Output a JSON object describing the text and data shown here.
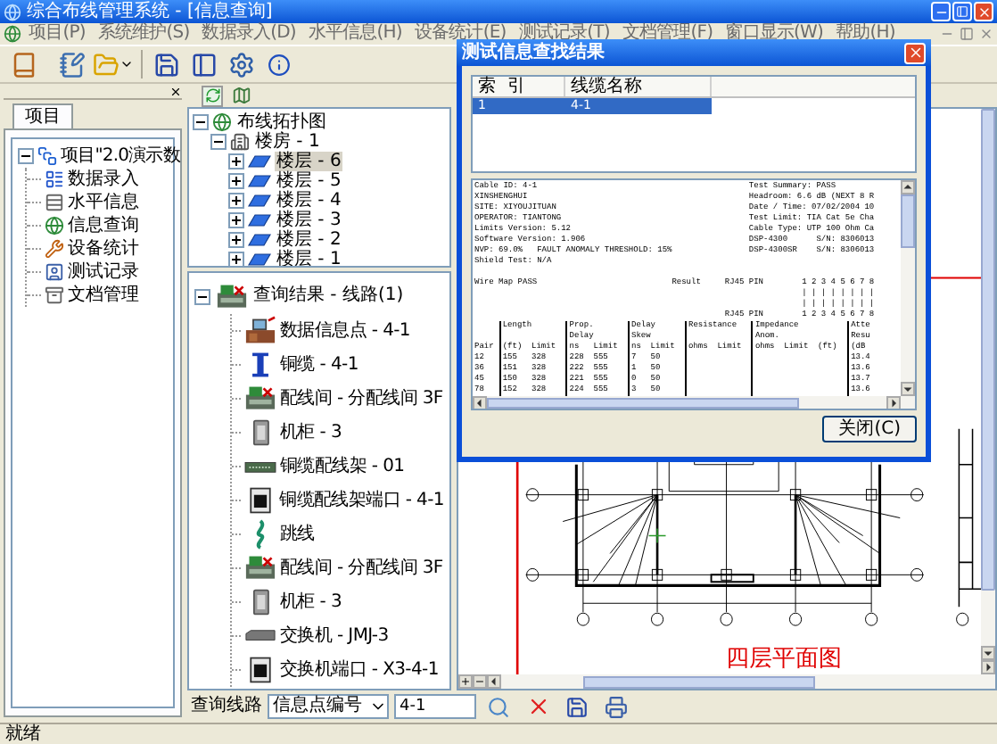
{
  "window": {
    "title": "综合布线管理系统 - [信息查询]"
  },
  "menu": [
    "项目(P)",
    "系统维护(S)",
    "数据录入(D)",
    "水平信息(H)",
    "设备统计(E)",
    "测试记录(T)",
    "文档管理(F)",
    "窗口显示(W)",
    "帮助(H)"
  ],
  "project_panel": {
    "tab": "项目",
    "tree": {
      "label": "项目\"2.0演示数",
      "kind": "project",
      "expanded": true,
      "children": [
        {
          "label": "数据录入",
          "kind": "entry"
        },
        {
          "label": "水平信息",
          "kind": "horizontal"
        },
        {
          "label": "信息查询",
          "kind": "query"
        },
        {
          "label": "设备统计",
          "kind": "stats"
        },
        {
          "label": "测试记录",
          "kind": "test"
        },
        {
          "label": "文档管理",
          "kind": "docs"
        }
      ]
    }
  },
  "topology_tree": {
    "label": "布线拓扑图",
    "kind": "map",
    "expanded": true,
    "children": [
      {
        "label": "楼房 - 1",
        "kind": "building",
        "expanded": true,
        "children": [
          {
            "label": "楼层 - 6",
            "kind": "floor",
            "expanded": false,
            "selected": true
          },
          {
            "label": "楼层 - 5",
            "kind": "floor",
            "expanded": false,
            "selected": false
          },
          {
            "label": "楼层 - 4",
            "kind": "floor",
            "expanded": false,
            "selected": false
          },
          {
            "label": "楼层 - 3",
            "kind": "floor",
            "expanded": false,
            "selected": false
          },
          {
            "label": "楼层 - 2",
            "kind": "floor",
            "expanded": false,
            "selected": false
          },
          {
            "label": "楼层 - 1",
            "kind": "floor",
            "expanded": false,
            "selected": false
          }
        ]
      }
    ]
  },
  "result_tree": {
    "label": "查询结果 - 线路(1)",
    "kind": "room",
    "expanded": true,
    "children": [
      {
        "label": "数据信息点 - 4-1",
        "kind": "outlet"
      },
      {
        "label": "铜缆 - 4-1",
        "kind": "cable"
      },
      {
        "label": "配线间 - 分配线间 3F",
        "kind": "room"
      },
      {
        "label": "机柜 - 3",
        "kind": "cabinet"
      },
      {
        "label": "铜缆配线架 - 01",
        "kind": "panel"
      },
      {
        "label": "铜缆配线架端口 - 4-1",
        "kind": "port"
      },
      {
        "label": "跳线",
        "kind": "jumper"
      },
      {
        "label": "配线间 - 分配线间 3F",
        "kind": "room"
      },
      {
        "label": "机柜 - 3",
        "kind": "cabinet"
      },
      {
        "label": "交换机 - JMJ-3",
        "kind": "switch"
      },
      {
        "label": "交换机端口 - X3-4-1",
        "kind": "port"
      }
    ]
  },
  "query_bar": {
    "label": "查询线路",
    "field": "信息点编号",
    "value": "4-1"
  },
  "drawing": {
    "caption": "四层平面图"
  },
  "dialog": {
    "title": "测试信息查找结果",
    "columns": [
      "索  引",
      "线缆名称"
    ],
    "rows": [
      {
        "cells": [
          "1",
          "4-1"
        ],
        "selected": true
      }
    ],
    "report": {
      "header": [
        {
          "left": "Cable ID: 4-1",
          "right": "Test Summary: PASS"
        },
        {
          "left": "XINSHENGHUI",
          "right": "Headroom: 6.6 dB (NEXT 8 R"
        },
        {
          "left": "SITE: XIYOUJITUAN",
          "right": "Date / Time: 07/02/2004 10"
        },
        {
          "left": "OPERATOR: TIANTONG",
          "right": "Test Limit: TIA Cat 5e Cha"
        },
        {
          "left": "Limits Version: 5.12",
          "right": "Cable Type: UTP 100 Ohm Ca"
        },
        {
          "left": "Software Version: 1.906",
          "right": "DSP-4300      S/N: 8306013"
        },
        {
          "left": "NVP: 69.0%   FAULT ANOMALY THRESHOLD: 15%",
          "right": "DSP-4300SR    S/N: 8306013"
        },
        {
          "left": "Shield Test: N/A"
        }
      ],
      "wire_map": [
        {
          "kind": "result",
          "cells": [
            "Wire Map PASS",
            "Result",
            "RJ45 PIN",
            "1 2 3 4 5 6 7 8"
          ]
        },
        {
          "kind": "bars",
          "cells": [
            "| | | | | | | |"
          ]
        },
        {
          "kind": "bars",
          "cells": [
            "| | | | | | | |"
          ]
        },
        {
          "kind": "pins",
          "cells": [
            "RJ45 PIN",
            "1 2 3 4 5 6 7 8"
          ]
        }
      ],
      "table": {
        "row_label": "Pair",
        "rows": [
          "12",
          "36",
          "45",
          "78"
        ],
        "groups": [
          {
            "title": [
              "Length"
            ],
            "columns": [
              "(ft)",
              "Limit"
            ],
            "values": [
              [
                "155",
                "328"
              ],
              [
                "151",
                "328"
              ],
              [
                "150",
                "328"
              ],
              [
                "152",
                "328"
              ]
            ]
          },
          {
            "title": [
              "Prop.",
              "Delay"
            ],
            "columns": [
              "ns",
              "Limit"
            ],
            "values": [
              [
                "228",
                "555"
              ],
              [
                "222",
                "555"
              ],
              [
                "221",
                "555"
              ],
              [
                "224",
                "555"
              ]
            ]
          },
          {
            "title": [
              "Delay",
              "Skew"
            ],
            "columns": [
              "ns",
              "Limit"
            ],
            "values": [
              [
                "7",
                "50"
              ],
              [
                "1",
                "50"
              ],
              [
                "0",
                "50"
              ],
              [
                "3",
                "50"
              ]
            ]
          },
          {
            "title": [
              "Resistance"
            ],
            "columns": [
              "ohms",
              "Limit"
            ]
          },
          {
            "title": [
              "Impedance",
              "Anom."
            ],
            "columns": [
              "ohms",
              "Limit",
              "(ft)"
            ]
          },
          {
            "title": [
              "Atte",
              "Resu"
            ],
            "columns": [
              "(dB"
            ],
            "values": [
              [
                "13.4"
              ],
              [
                "13.6"
              ],
              [
                "13.7"
              ],
              [
                "13.6"
              ]
            ]
          }
        ]
      }
    },
    "close_button": "关闭(C)"
  },
  "status_bar": "就绪"
}
